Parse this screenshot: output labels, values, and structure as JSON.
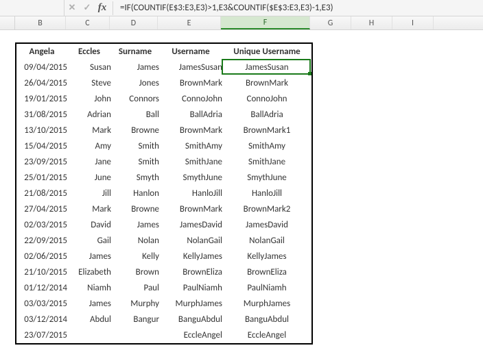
{
  "formula_bar": {
    "cancel": "✕",
    "confirm": "✓",
    "fx": "fx",
    "formula": "=IF(COUNTIF(E$3:E3,E3)>1,E3&COUNTIF($E$3:E3,E3)-1,E3)"
  },
  "columns": [
    "B",
    "C",
    "D",
    "E",
    "F",
    "G",
    "H",
    "I"
  ],
  "selected_column": "F",
  "headers": {
    "B": "Angela",
    "C": "Eccles",
    "D": "Surname",
    "E": "Username",
    "F": "Unique Username"
  },
  "rows": [
    {
      "B": "09/04/2015",
      "C": "Susan",
      "D": "James",
      "E": "JamesSusan",
      "F": "JamesSusan"
    },
    {
      "B": "26/04/2015",
      "C": "Steve",
      "D": "Jones",
      "E": "BrownMark",
      "F": "BrownMark"
    },
    {
      "B": "19/01/2015",
      "C": "John",
      "D": "Connors",
      "E": "ConnoJohn",
      "F": "ConnoJohn"
    },
    {
      "B": "31/08/2015",
      "C": "Adrian",
      "D": "Ball",
      "E": "BallAdria",
      "F": "BallAdria"
    },
    {
      "B": "13/10/2015",
      "C": "Mark",
      "D": "Browne",
      "E": "BrownMark",
      "F": "BrownMark1"
    },
    {
      "B": "15/04/2015",
      "C": "Amy",
      "D": "Smith",
      "E": "SmithAmy",
      "F": "SmithAmy"
    },
    {
      "B": "23/09/2015",
      "C": "Jane",
      "D": "Smith",
      "E": "SmithJane",
      "F": "SmithJane"
    },
    {
      "B": "25/01/2015",
      "C": "June",
      "D": "Smyth",
      "E": "SmythJune",
      "F": "SmythJune"
    },
    {
      "B": "21/08/2015",
      "C": "Jill",
      "D": "Hanlon",
      "E": "HanloJill",
      "F": "HanloJill"
    },
    {
      "B": "27/04/2015",
      "C": "Mark",
      "D": "Browne",
      "E": "BrownMark",
      "F": "BrownMark2"
    },
    {
      "B": "02/03/2015",
      "C": "David",
      "D": "James",
      "E": "JamesDavid",
      "F": "JamesDavid"
    },
    {
      "B": "22/09/2015",
      "C": "Gail",
      "D": "Nolan",
      "E": "NolanGail",
      "F": "NolanGail"
    },
    {
      "B": "02/06/2015",
      "C": "James",
      "D": "Kelly",
      "E": "KellyJames",
      "F": "KellyJames"
    },
    {
      "B": "21/10/2015",
      "C": "Elizabeth",
      "D": "Brown",
      "E": "BrownEliza",
      "F": "BrownEliza"
    },
    {
      "B": "01/12/2014",
      "C": "Niamh",
      "D": "Paul",
      "E": "PaulNiamh",
      "F": "PaulNiamh"
    },
    {
      "B": "03/03/2015",
      "C": "James",
      "D": "Murphy",
      "E": "MurphJames",
      "F": "MurphJames"
    },
    {
      "B": "03/12/2014",
      "C": "Abdul",
      "D": "Bangur",
      "E": "BanguAbdul",
      "F": "BanguAbdul"
    },
    {
      "B": "23/07/2015",
      "C": "",
      "D": "",
      "E": "EccleAngel",
      "F": "EccleAngel"
    }
  ],
  "selection": {
    "row_index": 0,
    "col": "F"
  }
}
